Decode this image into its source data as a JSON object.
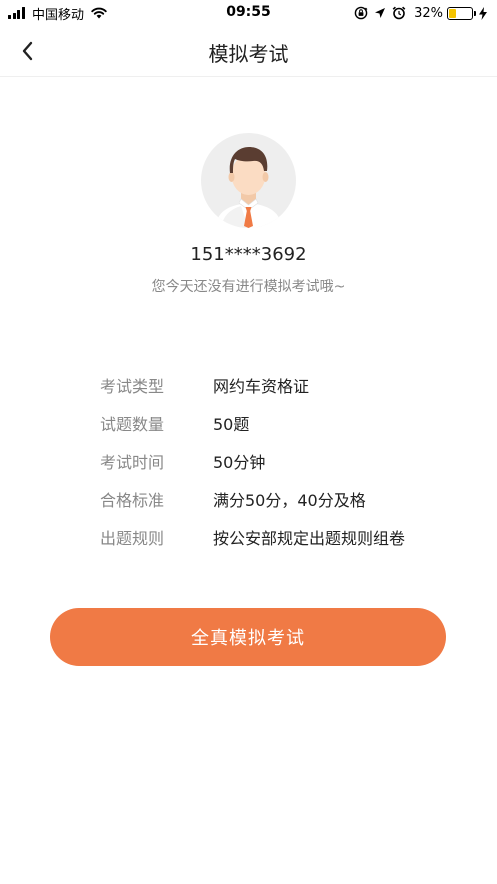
{
  "status_bar": {
    "carrier": "中国移动",
    "time": "09:55",
    "battery_percent": "32%",
    "battery_level": 0.32,
    "battery_color": "#f5c400",
    "icons": [
      "signal-icon",
      "wifi-icon",
      "screen-lock-icon",
      "location-icon",
      "alarm-icon",
      "charging-icon"
    ]
  },
  "nav": {
    "back_icon": "chevron-left-icon",
    "title": "模拟考试"
  },
  "profile": {
    "avatar_icon": "user-avatar-icon",
    "phone": "151****3692",
    "message": "您今天还没有进行模拟考试哦~"
  },
  "info": {
    "rows": [
      {
        "label": "考试类型",
        "value": "网约车资格证"
      },
      {
        "label": "试题数量",
        "value": "50题"
      },
      {
        "label": "考试时间",
        "value": "50分钟"
      },
      {
        "label": "合格标准",
        "value": "满分50分，40分及格"
      },
      {
        "label": "出题规则",
        "value": "按公安部规定出题规则组卷"
      }
    ]
  },
  "actions": {
    "start_label": "全真模拟考试",
    "accent_color": "#f07a45"
  }
}
